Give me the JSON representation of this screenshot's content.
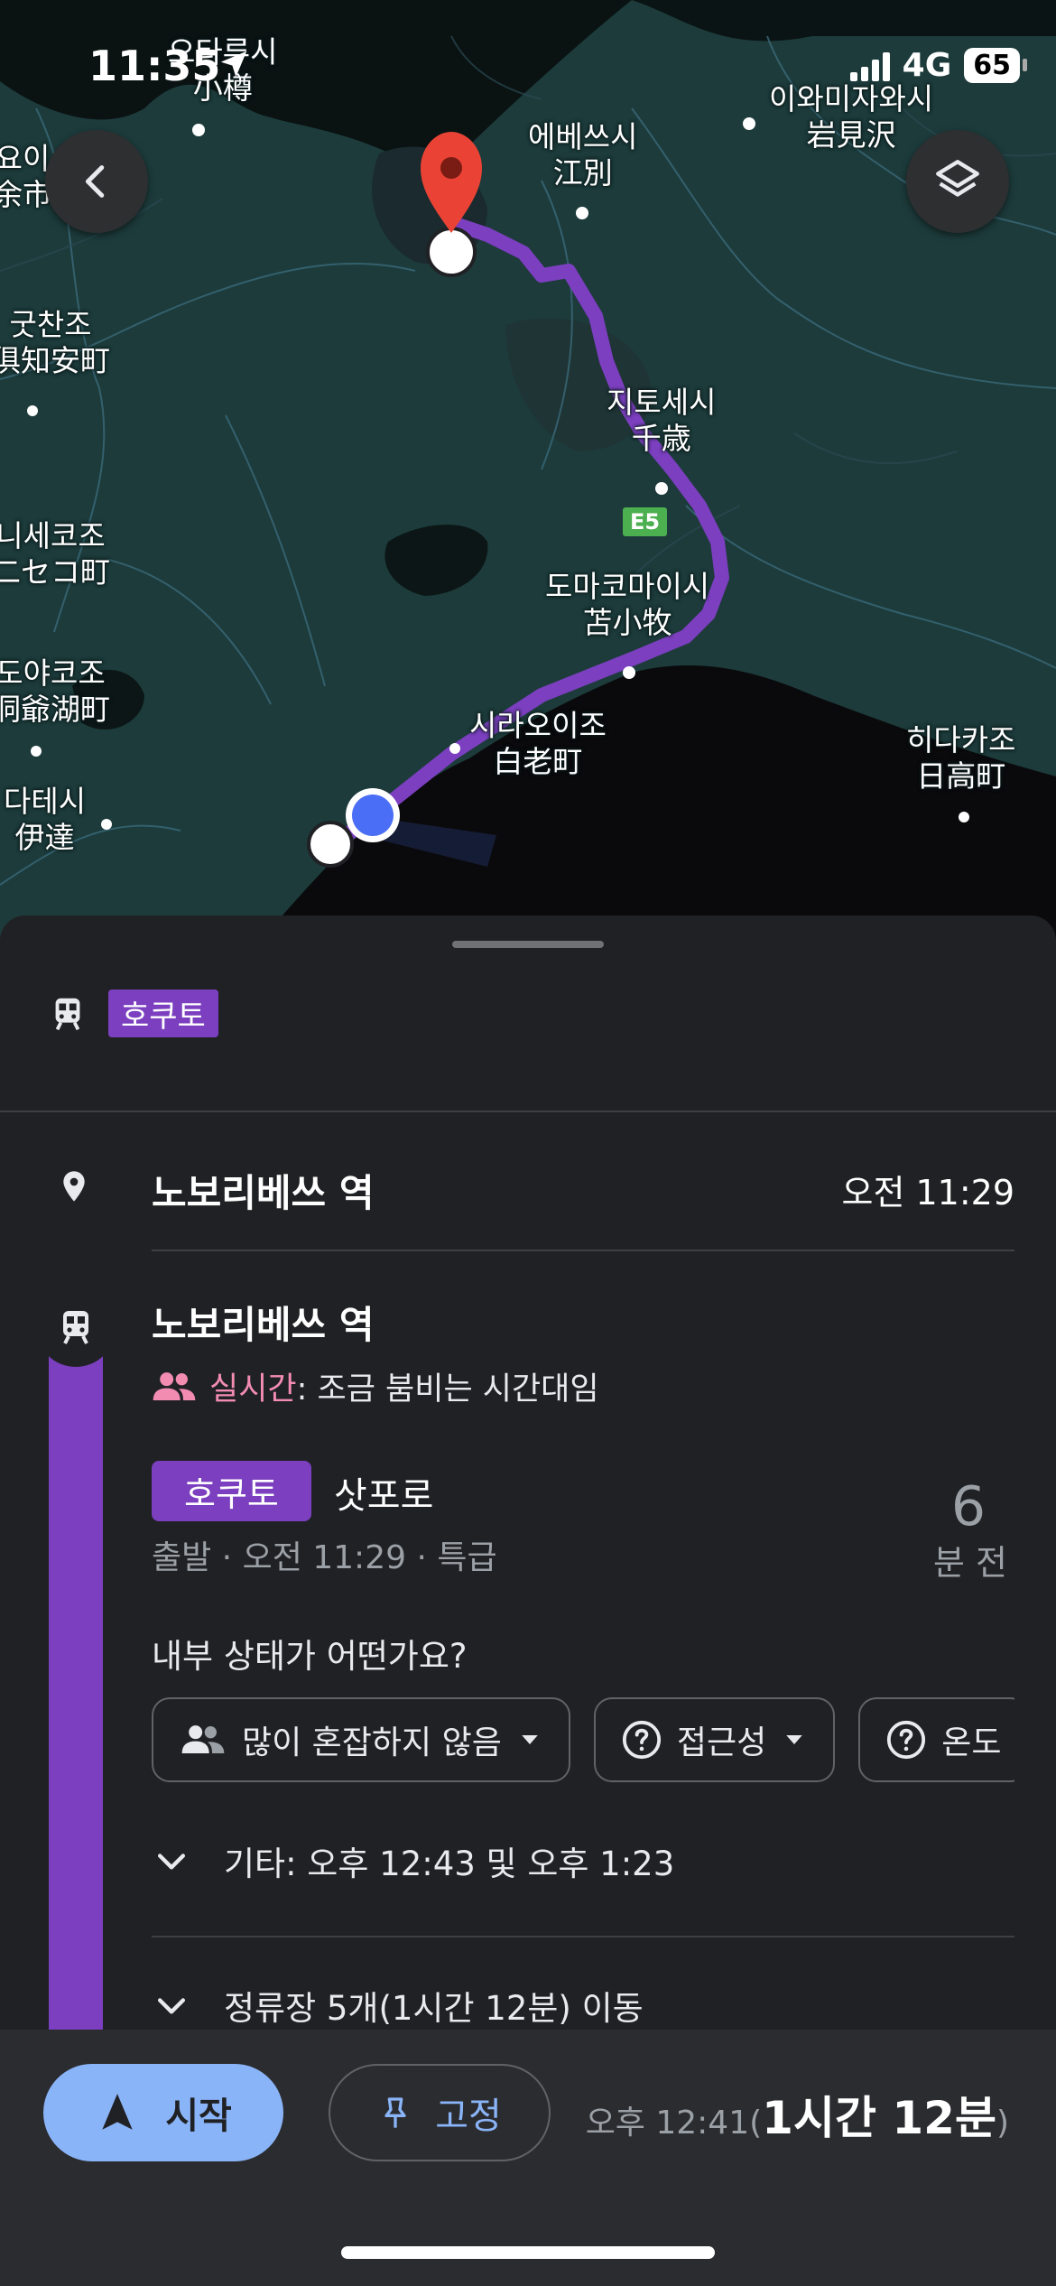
{
  "status_bar": {
    "time": "11:35",
    "network": "4G",
    "battery": "65"
  },
  "map": {
    "labels": [
      {
        "id": "otaru",
        "text": "오타루시\n小樽"
      },
      {
        "id": "yoichi",
        "text": "요이\n余市"
      },
      {
        "id": "ebetsu",
        "text": "에베쓰시\n江別"
      },
      {
        "id": "iwamizawa",
        "text": "이와미자와시\n岩見沢"
      },
      {
        "id": "kutchan",
        "text": "굿찬조\n俱知安町"
      },
      {
        "id": "chitose",
        "text": "지토세시\n千歳"
      },
      {
        "id": "niseko",
        "text": "니세코조\n二セコ町"
      },
      {
        "id": "tomakomai",
        "text": "도마코마이시\n苫小牧"
      },
      {
        "id": "toyako",
        "text": "도야코조\n洞爺湖町"
      },
      {
        "id": "shiraoi",
        "text": "시라오이조\n白老町"
      },
      {
        "id": "hidaka",
        "text": "히다카조\n日高町"
      },
      {
        "id": "date",
        "text": "다테시\n伊達"
      }
    ],
    "highway_shield": "E5",
    "back_button_icon": "chevron-left-icon",
    "layers_button_icon": "layers-icon"
  },
  "sheet": {
    "summary_line": "호쿠토",
    "origin": {
      "name": "노보리베쓰 역",
      "time": "오전 11:29"
    },
    "stop": {
      "name": "노보리베쓰 역",
      "crowd_live_label": "실시간",
      "crowd_text": ": 조금 붐비는 시간대임"
    },
    "departure": {
      "line": "호쿠토",
      "destination": "삿포로",
      "meta": "출발 · 오전 11:29 · 특급",
      "minutes": "6",
      "minutes_unit": "분 전"
    },
    "question": "내부 상태가 어떤가요?",
    "chips": [
      {
        "label": "많이 혼잡하지 않음",
        "icon": "people-icon"
      },
      {
        "label": "접근성",
        "icon": "question-circle-icon"
      },
      {
        "label": "온도",
        "icon": "question-circle-icon"
      }
    ],
    "other_times": "기타: 오후 12:43 및 오후 1:23",
    "stops_summary": "정류장 5개(1시간 12분) 이동"
  },
  "bottom": {
    "start_label": "시작",
    "pin_label": "고정",
    "eta_time": "오후 12:41(",
    "eta_duration": "1시간 12분",
    "eta_close": ")"
  },
  "colors": {
    "route": "#7b3fbf",
    "accent": "#8ab4f8",
    "live": "#f28cb1"
  }
}
